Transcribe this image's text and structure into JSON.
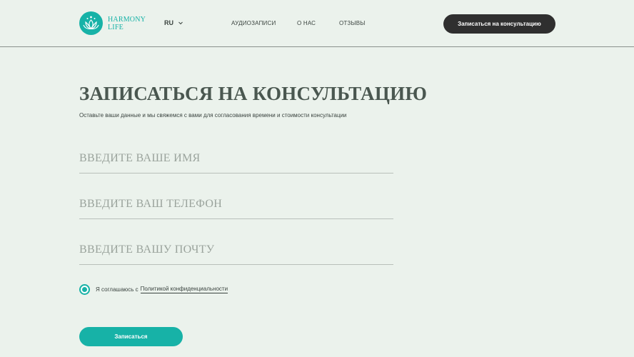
{
  "header": {
    "logo_line1": "HARMONY",
    "logo_line2": "LIFE",
    "lang": "RU",
    "nav": {
      "audio": "АУДИОЗАПИСИ",
      "about": "О НАС",
      "reviews": "ОТЗЫВЫ"
    },
    "cta_label": "Записаться на консультацию"
  },
  "form": {
    "title": "ЗАПИСАТЬСЯ НА КОНСУЛЬТАЦИЮ",
    "subtitle": "Оставьте ваши данные и мы свяжемся с вами для согласования времени и стоимости консультации",
    "name_placeholder": "ВВЕДИТЕ ВАШЕ ИМЯ",
    "phone_placeholder": "ВВЕДИТЕ ВАШ ТЕЛЕФОН",
    "email_placeholder": "ВВЕДИТЕ ВАШУ ПОЧТУ",
    "consent_text": "Я соглашаюсь с",
    "consent_link": "Политикой конфиденциальности",
    "consent_checked": true,
    "submit_label": "Записаться"
  },
  "colors": {
    "background": "#ebf2ec",
    "accent": "#17b2a7",
    "dark_button": "#2f2f2f"
  },
  "icons": {
    "logo": "lotus-icon",
    "lang_dropdown": "chevron-down-icon"
  }
}
